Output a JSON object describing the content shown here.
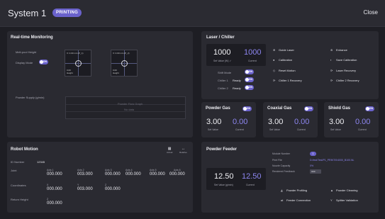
{
  "header": {
    "title": "System 1",
    "status": "PRINTING",
    "close_label": "Close"
  },
  "realtime": {
    "title": "Real-time Monitoring",
    "melt_pool_label": "Melt-pool Height",
    "display_mode_label": "Display Mode",
    "display_mode_toggle": "ON",
    "cameras": [
      {
        "top_label": "X: 0.00 mm (P_1)",
        "bottom_label": "0.00\nHeight"
      },
      {
        "top_label": "X: 0.00 mm (P_2)",
        "bottom_label": "0.00\nHeight"
      }
    ],
    "powder_label": "Powder Supply (g/min)",
    "powder_note": "Powder Flow Graph",
    "powder_sub": "No data"
  },
  "laser": {
    "title": "Laser / Chiller",
    "setpoint": "1000",
    "setpoint_label": "Set Value (W) ✓",
    "current": "1000",
    "current_label": "Current",
    "rows": [
      {
        "label": "Shift Mode",
        "state": "",
        "toggle": "ON"
      },
      {
        "label": "Chiller 1",
        "state": "Ready",
        "toggle": "ON"
      },
      {
        "label": "Chiller 2",
        "state": "Ready",
        "toggle": "ON"
      }
    ],
    "actions": [
      {
        "icon": "guide-laser-icon",
        "glyph": "⊕",
        "label": "Guide Laser"
      },
      {
        "icon": "enhance-icon",
        "glyph": "⊛",
        "label": "Enhance"
      },
      {
        "icon": "calibration-icon",
        "glyph": "●",
        "label": "Calibration"
      },
      {
        "icon": "save-icon",
        "glyph": "▪",
        "label": "Save Calibration"
      },
      {
        "icon": "reset-icon",
        "glyph": "◇",
        "label": "Reset Motion"
      },
      {
        "icon": "laser-recovery-icon",
        "glyph": "⟳",
        "label": "Laser Recovery"
      },
      {
        "icon": "chiller1-recovery-icon",
        "glyph": "⟳",
        "label": "Chiller 1 Recovery"
      },
      {
        "icon": "chiller2-recovery-icon",
        "glyph": "⟳",
        "label": "Chiller 2 Recovery"
      }
    ]
  },
  "gases": [
    {
      "title": "Powder Gas",
      "toggle": "ON",
      "set": "3.00",
      "set_label": "Set Value",
      "current": "0.00",
      "current_label": "Current"
    },
    {
      "title": "Coaxial Gas",
      "toggle": "ON",
      "set": "3.00",
      "set_label": "Set Value",
      "current": "0.00",
      "current_label": "Current"
    },
    {
      "title": "Shield Gas",
      "toggle": "ON",
      "set": "3.00",
      "set_label": "Set Value",
      "current": "0.00",
      "current_label": "Current"
    }
  ],
  "robot": {
    "title": "Robot Motion",
    "abs_label": "Actual",
    "rel_label": "Relative",
    "id_label": "ID Number",
    "id_value": "12345",
    "joint_label": "Joint",
    "axes": [
      {
        "name": "Axis 1",
        "value": "000.000"
      },
      {
        "name": "Axis 2",
        "value": "003.000"
      },
      {
        "name": "Axis 3",
        "value": "000.000"
      },
      {
        "name": "Axis 4",
        "value": "000.000"
      },
      {
        "name": "Axis 5",
        "value": "000.000"
      },
      {
        "name": "Axis 6",
        "value": "000.000"
      }
    ],
    "coord_label": "Coordinates",
    "coords": [
      {
        "name": "X",
        "value": "000.000"
      },
      {
        "name": "Y",
        "value": "003.000"
      },
      {
        "name": "Z",
        "value": "000.000"
      }
    ],
    "return_label": "Return Height",
    "return_name": "Z",
    "return_value": "000.000"
  },
  "feeder": {
    "title": "Powder Feeder",
    "module_label": "Module Number",
    "module_value": "1",
    "file_label": "Print File",
    "file_value": "D:/test/Test/P1_PRINT/0/4000_B100.NL",
    "capacity_label": "Nozzle Capacity",
    "capacity_value": "0%",
    "feedback_label": "Rendered Feedback",
    "feedback_value": "OFF",
    "set": "12.50",
    "set_label": "Set Value (g/min)",
    "current": "12.50",
    "current_label": "Current",
    "actions": [
      {
        "icon": "powder-profiling-icon",
        "glyph": "◭",
        "label": "Powder Profiling"
      },
      {
        "icon": "powder-cleaning-icon",
        "glyph": "▲",
        "label": "Powder Cleaning"
      },
      {
        "icon": "feeder-connection-icon",
        "glyph": "⇌",
        "label": "Feeder Connection"
      },
      {
        "icon": "splitter-validation-icon",
        "glyph": "Y",
        "label": "Splitter Validation"
      }
    ]
  }
}
